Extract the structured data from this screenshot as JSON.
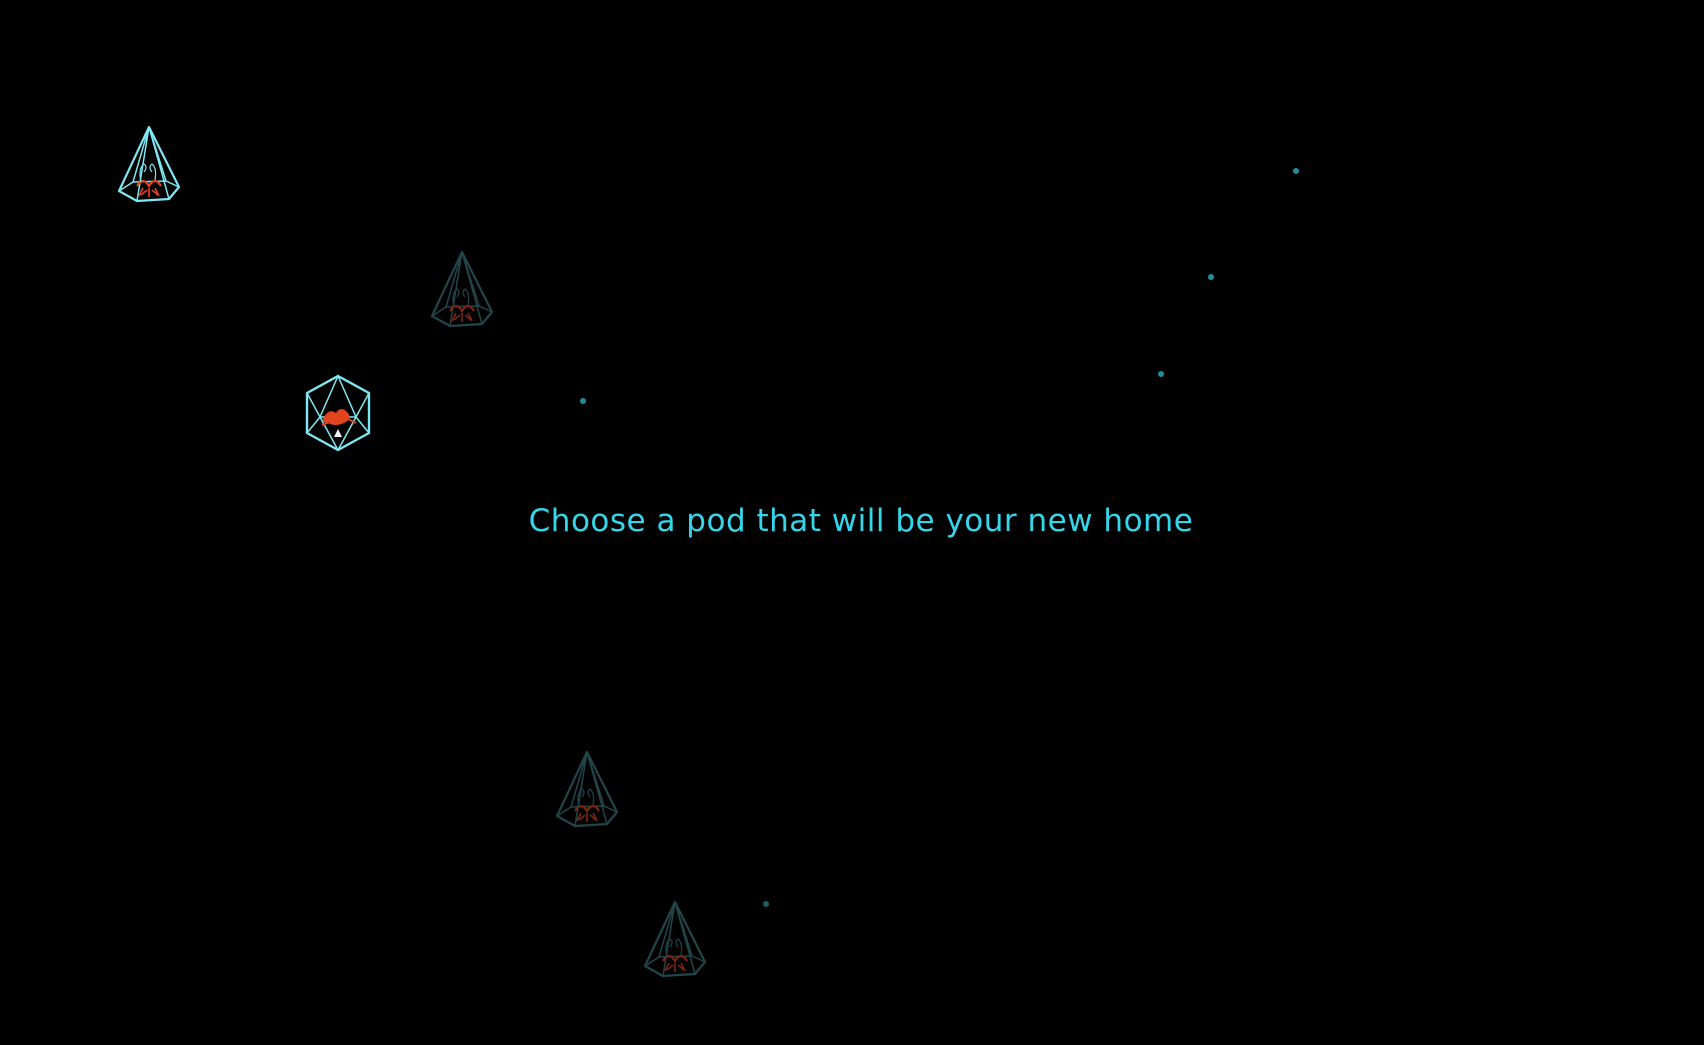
{
  "prompt": {
    "text": "Choose a pod that will be your new home"
  },
  "colors": {
    "background": "#000000",
    "accent": "#35d6ea",
    "pod_bright": "#7fe6f2",
    "pod_dim": "#3f7f86",
    "plant": "#e2451d",
    "star": "#1f8f99"
  },
  "pods": [
    {
      "id": "pod-1",
      "shape": "pyramid",
      "state": "highlighted",
      "icon": "terrarium-pyramid-icon"
    },
    {
      "id": "pod-2",
      "shape": "pyramid",
      "state": "dim",
      "icon": "terrarium-pyramid-icon"
    },
    {
      "id": "pod-3",
      "shape": "hexagon",
      "state": "highlighted",
      "icon": "terrarium-hexagon-icon"
    },
    {
      "id": "pod-4",
      "shape": "pyramid",
      "state": "dim",
      "icon": "terrarium-pyramid-icon"
    },
    {
      "id": "pod-5",
      "shape": "pyramid",
      "state": "dim",
      "icon": "terrarium-pyramid-icon"
    }
  ]
}
